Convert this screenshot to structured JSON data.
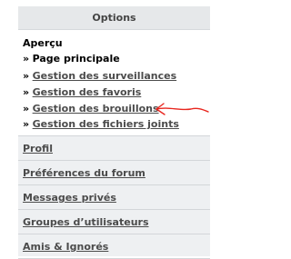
{
  "panel": {
    "header": "Options",
    "section_title": "Aperçu",
    "items": [
      {
        "prefix": "»",
        "label": "Page principale",
        "active": true
      },
      {
        "prefix": "»",
        "label": "Gestion des surveillances"
      },
      {
        "prefix": "»",
        "label": "Gestion des favoris"
      },
      {
        "prefix": "»",
        "label": "Gestion des brouillons"
      },
      {
        "prefix": "»",
        "label": "Gestion des fichiers joints"
      }
    ]
  },
  "nav": [
    {
      "label": "Profil"
    },
    {
      "label": "Préférences du forum"
    },
    {
      "label": "Messages privés"
    },
    {
      "label": "Groupes d’utilisateurs"
    },
    {
      "label": "Amis & Ignorés"
    }
  ],
  "annotation": {
    "color": "#e8261e",
    "icon": "red-arrow-icon"
  }
}
